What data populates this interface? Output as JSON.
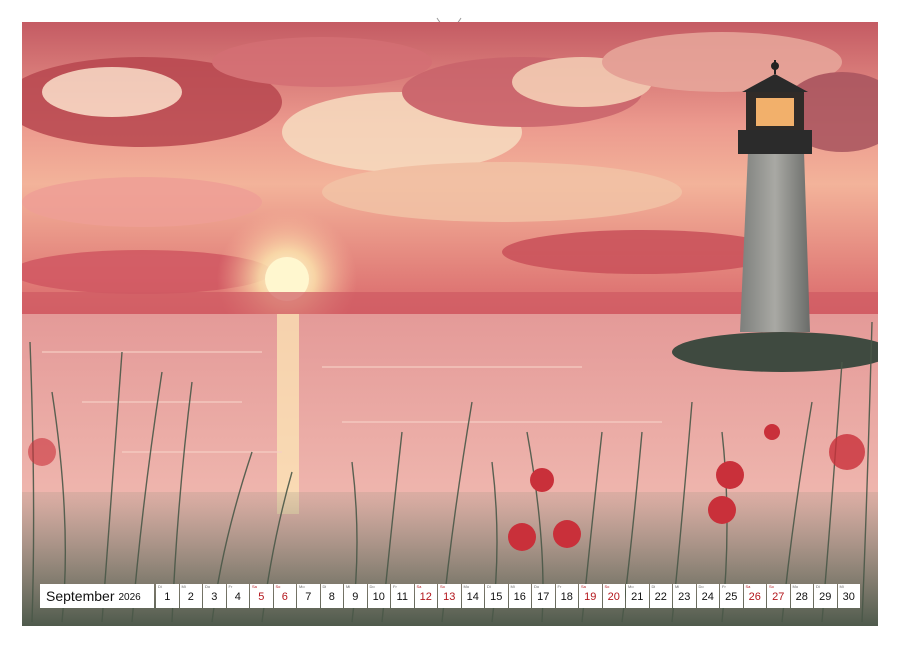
{
  "calendar": {
    "month": "September",
    "year": "2026",
    "days": [
      {
        "n": "1",
        "w": "Di",
        "weekend": false
      },
      {
        "n": "2",
        "w": "Mi",
        "weekend": false
      },
      {
        "n": "3",
        "w": "Do",
        "weekend": false
      },
      {
        "n": "4",
        "w": "Fr",
        "weekend": false
      },
      {
        "n": "5",
        "w": "Sa",
        "weekend": true
      },
      {
        "n": "6",
        "w": "So",
        "weekend": true
      },
      {
        "n": "7",
        "w": "Mo",
        "weekend": false
      },
      {
        "n": "8",
        "w": "Di",
        "weekend": false
      },
      {
        "n": "9",
        "w": "Mi",
        "weekend": false
      },
      {
        "n": "10",
        "w": "Do",
        "weekend": false
      },
      {
        "n": "11",
        "w": "Fr",
        "weekend": false
      },
      {
        "n": "12",
        "w": "Sa",
        "weekend": true
      },
      {
        "n": "13",
        "w": "So",
        "weekend": true
      },
      {
        "n": "14",
        "w": "Mo",
        "weekend": false
      },
      {
        "n": "15",
        "w": "Di",
        "weekend": false
      },
      {
        "n": "16",
        "w": "Mi",
        "weekend": false
      },
      {
        "n": "17",
        "w": "Do",
        "weekend": false
      },
      {
        "n": "18",
        "w": "Fr",
        "weekend": false
      },
      {
        "n": "19",
        "w": "Sa",
        "weekend": true
      },
      {
        "n": "20",
        "w": "So",
        "weekend": true
      },
      {
        "n": "21",
        "w": "Mo",
        "weekend": false
      },
      {
        "n": "22",
        "w": "Di",
        "weekend": false
      },
      {
        "n": "23",
        "w": "Mi",
        "weekend": false
      },
      {
        "n": "24",
        "w": "Do",
        "weekend": false
      },
      {
        "n": "25",
        "w": "Fr",
        "weekend": false
      },
      {
        "n": "26",
        "w": "Sa",
        "weekend": true
      },
      {
        "n": "27",
        "w": "So",
        "weekend": true
      },
      {
        "n": "28",
        "w": "Mo",
        "weekend": false
      },
      {
        "n": "29",
        "w": "Di",
        "weekend": false
      },
      {
        "n": "30",
        "w": "Mi",
        "weekend": false
      }
    ]
  },
  "colors": {
    "sky_top": "#c9565a",
    "sky_mid": "#e98a86",
    "sun": "#fff6c8",
    "water": "#e8a3a0",
    "lighthouse": "#8e8e8a",
    "lantern": "#2d2d2d",
    "grass": "#4a5a4a",
    "poppy": "#c9303a",
    "weekend": "#b3151b"
  }
}
